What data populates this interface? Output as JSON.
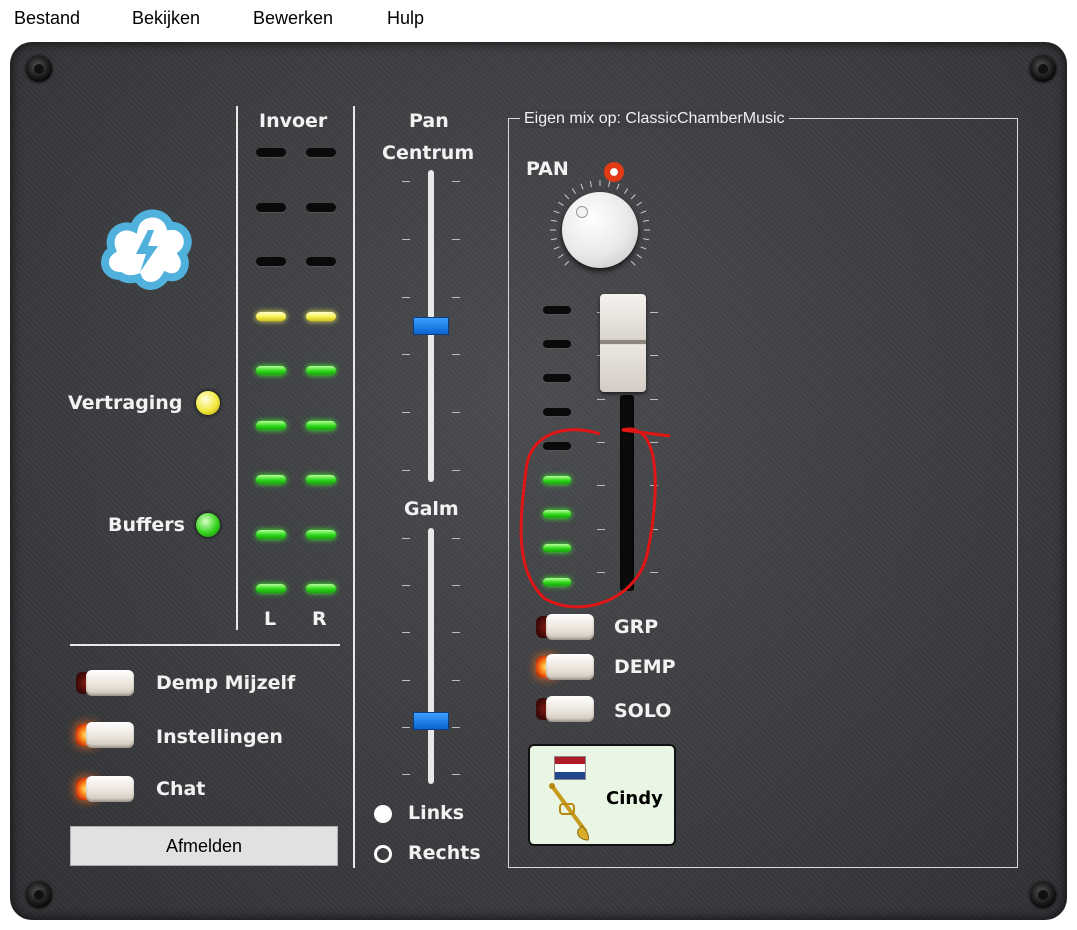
{
  "menu": [
    "Bestand",
    "Bekijken",
    "Bewerken",
    "Hulp"
  ],
  "input_meter": {
    "title": "Invoer",
    "left_label": "L",
    "right_label": "R",
    "levels": [
      "off",
      "off",
      "off",
      "yellow",
      "green",
      "green",
      "green",
      "green",
      "green"
    ]
  },
  "status": {
    "delay_label": "Vertraging",
    "delay_color": "#f3e83c",
    "buffers_label": "Buffers",
    "buffers_color": "#34d31c"
  },
  "controls": {
    "mute_self": "Demp Mijzelf",
    "settings": "Instellingen",
    "chat": "Chat",
    "logout": "Afmelden"
  },
  "pan": {
    "title": "Pan",
    "value": "Centrum",
    "reverb_title": "Galm",
    "left": "Links",
    "right": "Rechts",
    "selected": "Links"
  },
  "mixer": {
    "title": "Eigen mix op: ClassicChamberMusic",
    "pan_label": "PAN",
    "meter_levels": [
      "off",
      "off",
      "off",
      "off",
      "off",
      "green",
      "green",
      "green",
      "green"
    ],
    "grp": "GRP",
    "mute": "DEMP",
    "solo": "SOLO",
    "user": {
      "name": "Cindy",
      "country_flag": "netherlands-flag-icon",
      "instrument_icon": "trumpet-icon"
    }
  },
  "toggles": {
    "mute_self_on": false,
    "settings_on": true,
    "chat_on": true,
    "grp_on": false,
    "mute_on": true,
    "solo_on": false
  }
}
